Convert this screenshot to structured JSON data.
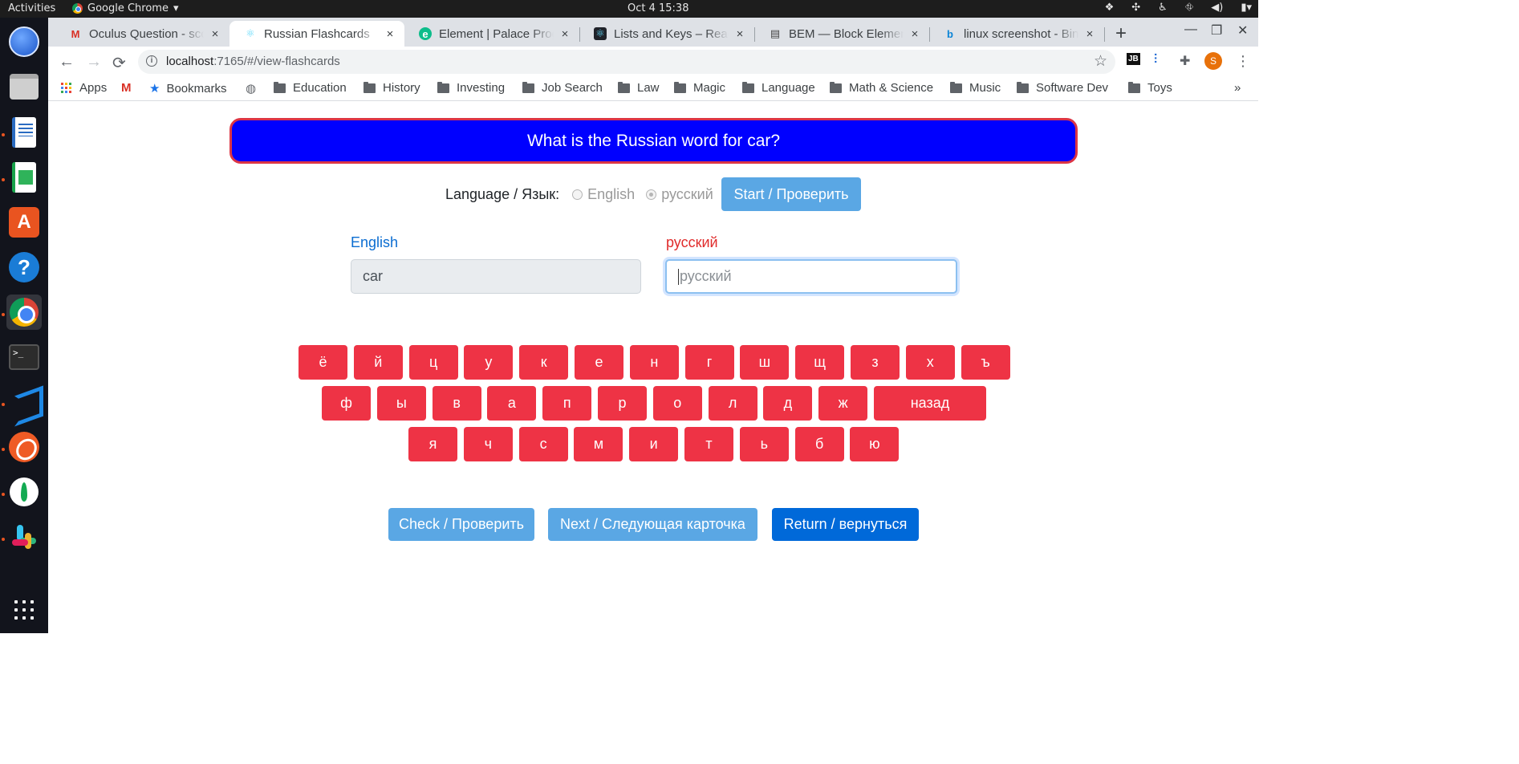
{
  "system": {
    "activities": "Activities",
    "app_name": "Google Chrome",
    "app_menu_arrow": "▾",
    "clock": "Oct 4  15:38",
    "tray_icons": [
      "dropbox-icon",
      "slack-tray-icon",
      "accessibility-icon",
      "network-icon",
      "volume-icon",
      "battery-icon"
    ]
  },
  "dock": {
    "items": [
      "thunderbird-mail",
      "files",
      "libreoffice-writer",
      "libreoffice-calc",
      "ubuntu-software",
      "help",
      "google-chrome",
      "terminal",
      "vscode",
      "postman",
      "mongodb-compass",
      "slack",
      "show-applications"
    ],
    "terminal_prompt": ">_"
  },
  "browser": {
    "tabs": [
      {
        "title": "Oculus Question - sco",
        "favicon": "gmail-icon",
        "close": "×"
      },
      {
        "title": "Russian Flashcards",
        "favicon": "react-icon",
        "close": "×"
      },
      {
        "title": "Element | Palace Prog",
        "favicon": "element-icon",
        "close": "×"
      },
      {
        "title": "Lists and Keys – Reac",
        "favicon": "react-icon",
        "close": "×"
      },
      {
        "title": "BEM — Block Elemen",
        "favicon": "doc-icon",
        "close": "×"
      },
      {
        "title": "linux screenshot - Bin",
        "favicon": "bing-icon",
        "close": "×"
      }
    ],
    "new_tab": "+",
    "window_controls": {
      "minimize": "—",
      "restore": "❐",
      "close": "✕"
    },
    "nav": {
      "back": "←",
      "forward": "→",
      "reload": "⟳"
    },
    "url_host": "localhost",
    "url_path": ":7165/#/view-flashcards",
    "star": "☆",
    "extensions": {
      "jetbrains": "JB",
      "menu": "⋮"
    },
    "profile_initial": "S",
    "bookmarks": [
      {
        "label": "Apps",
        "icon": "apps-icon"
      },
      {
        "label": "",
        "icon": "gmail-icon"
      },
      {
        "label": "Bookmarks",
        "icon": "star-icon"
      },
      {
        "label": "",
        "icon": "globe-icon"
      },
      {
        "label": "Education",
        "icon": "folder-icon"
      },
      {
        "label": "History",
        "icon": "folder-icon"
      },
      {
        "label": "Investing",
        "icon": "folder-icon"
      },
      {
        "label": "Job Search",
        "icon": "folder-icon"
      },
      {
        "label": "Law",
        "icon": "folder-icon"
      },
      {
        "label": "Magic",
        "icon": "folder-icon"
      },
      {
        "label": "Language",
        "icon": "folder-icon"
      },
      {
        "label": "Math & Science",
        "icon": "folder-icon"
      },
      {
        "label": "Music",
        "icon": "folder-icon"
      },
      {
        "label": "Software Dev",
        "icon": "folder-icon"
      },
      {
        "label": "Toys",
        "icon": "folder-icon"
      }
    ],
    "bookmarks_overflow": "»"
  },
  "app": {
    "question": "What is the Russian word for car?",
    "language_label": "Language / Язык:",
    "lang_options": [
      {
        "label": "English",
        "checked": false
      },
      {
        "label": "русский",
        "checked": true
      }
    ],
    "start_button": "Start / Проверить",
    "english_label": "English",
    "english_value": "car",
    "russian_label": "русский",
    "russian_placeholder": "русский",
    "keyboard": {
      "row1": [
        "ё",
        "й",
        "ц",
        "у",
        "к",
        "е",
        "н",
        "г",
        "ш",
        "щ",
        "з",
        "х",
        "ъ"
      ],
      "row2": [
        "ф",
        "ы",
        "в",
        "а",
        "п",
        "р",
        "о",
        "л",
        "д",
        "ж",
        "назад"
      ],
      "row3": [
        "я",
        "ч",
        "с",
        "м",
        "и",
        "т",
        "ь",
        "б",
        "ю"
      ]
    },
    "check_button": "Check / Проверить",
    "next_button": "Next / Следующая карточка",
    "return_button": "Return / вернуться"
  },
  "colors": {
    "banner": "#0000ff",
    "banner_border": "#dc3545",
    "key": "#ee3345",
    "primary_light": "#5aa7e4",
    "primary": "#0069d9"
  }
}
